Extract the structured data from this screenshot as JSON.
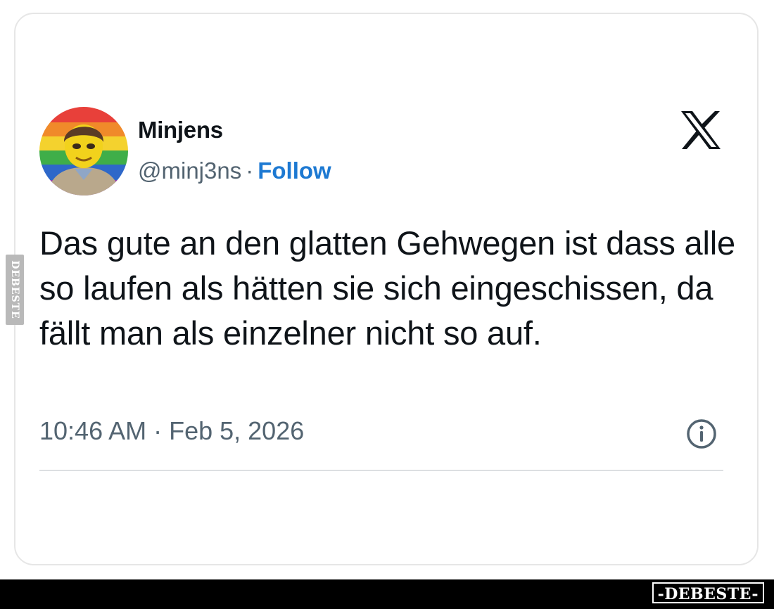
{
  "tweet": {
    "author_name": "Minjens",
    "handle": "@minj3ns",
    "separator": "·",
    "follow_label": "Follow",
    "text": "Das gute an den glatten Gehwegen ist dass alle so laufen als hätten sie sich eingeschissen, da fällt man als einzelner nicht so auf.",
    "timestamp": "10:46 AM · Feb 5, 2026",
    "platform_icon": "x-logo-icon",
    "info_icon": "info-icon"
  },
  "watermark": {
    "side_label": "DEBESTE",
    "brand_badge": "-DEBESTE-"
  },
  "colors": {
    "text_primary": "#0f1419",
    "text_secondary": "#536471",
    "link": "#1d79d2",
    "bottom_bar": "#000000"
  }
}
